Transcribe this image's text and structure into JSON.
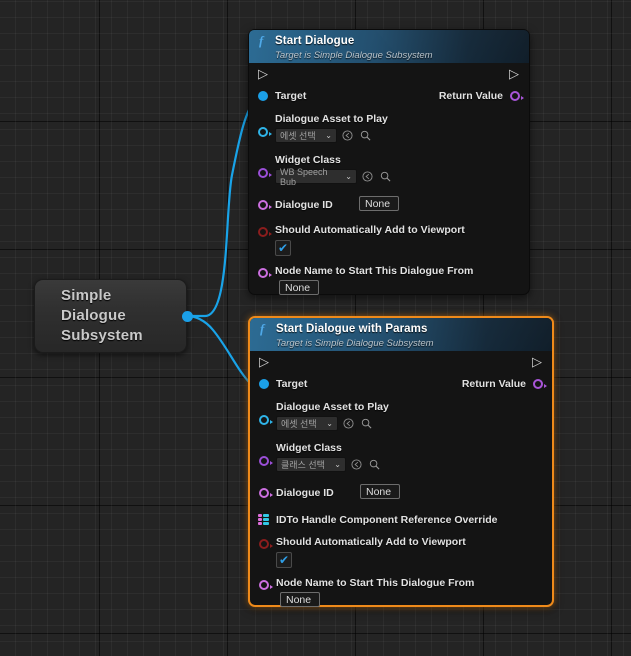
{
  "graph": {
    "background_color": "#242424",
    "grid_color": "#2f2f2f",
    "wire_color": "#19a3e8",
    "selection_color": "#ef8a1a"
  },
  "variable_node": {
    "title_lines": [
      "Simple",
      "Dialogue",
      "Subsystem"
    ],
    "output_pin_name": "object-output-pin",
    "pin_color": "#1ba0e8"
  },
  "nodes": [
    {
      "title": "Start Dialogue",
      "subtitle": "Target is Simple Dialogue Subsystem",
      "icon": "function-f-icon",
      "selected": false,
      "exec_in_label": "exec-in",
      "exec_out_label": "exec-out",
      "pins": {
        "target": {
          "label": "Target",
          "color": "#1ba0e8"
        },
        "return_value": {
          "label": "Return Value",
          "color": "#a855d8"
        },
        "dialogue_asset": {
          "label": "Dialogue Asset to Play",
          "color": "#2fb4e8",
          "value": "에셋 선택",
          "browse_icon": "browse-back-icon",
          "search_icon": "search-icon"
        },
        "widget_class": {
          "label": "Widget Class",
          "color": "#9b4fd8",
          "value": "WB Speech Bub",
          "browse_icon": "browse-back-icon",
          "search_icon": "search-icon"
        },
        "dialogue_id": {
          "label": "Dialogue ID",
          "color": "#cc6fe0",
          "value": "None"
        },
        "auto_viewport": {
          "label": "Should Automatically Add to Viewport",
          "color": "#8b1d1d",
          "checked": true,
          "check_glyph": "✔"
        },
        "node_name": {
          "label": "Node Name to Start This Dialogue From",
          "color": "#cc6fe0",
          "value": "None"
        }
      }
    },
    {
      "title": "Start Dialogue with Params",
      "subtitle": "Target is Simple Dialogue Subsystem",
      "icon": "function-f-icon",
      "selected": true,
      "exec_in_label": "exec-in",
      "exec_out_label": "exec-out",
      "pins": {
        "target": {
          "label": "Target",
          "color": "#1ba0e8"
        },
        "return_value": {
          "label": "Return Value",
          "color": "#a855d8"
        },
        "dialogue_asset": {
          "label": "Dialogue Asset to Play",
          "color": "#2fb4e8",
          "value": "에셋 선택",
          "browse_icon": "browse-back-icon",
          "search_icon": "search-icon"
        },
        "widget_class": {
          "label": "Widget Class",
          "color": "#9b4fd8",
          "value": "클래스 선택",
          "browse_icon": "browse-back-icon",
          "search_icon": "search-icon"
        },
        "dialogue_id": {
          "label": "Dialogue ID",
          "color": "#cc6fe0",
          "value": "None"
        },
        "id_to_handle": {
          "label": "IDTo Handle Component Reference Override",
          "icon": "map-pin-icon",
          "color_key": "#e06edb",
          "color_value": "#32c8e6"
        },
        "auto_viewport": {
          "label": "Should Automatically Add to Viewport",
          "color": "#8b1d1d",
          "checked": true,
          "check_glyph": "✔"
        },
        "node_name": {
          "label": "Node Name to Start This Dialogue From",
          "color": "#cc6fe0",
          "value": "None"
        }
      }
    }
  ]
}
